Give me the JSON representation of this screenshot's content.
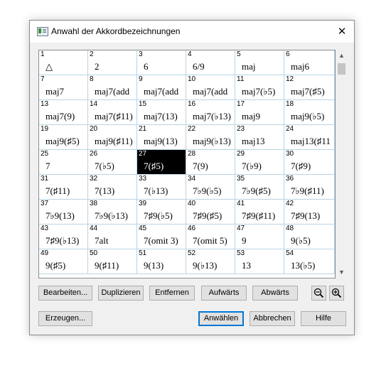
{
  "window": {
    "title": "Anwahl der Akkordbezeichnungen",
    "close_glyph": "✕"
  },
  "chords": [
    {
      "num": "1",
      "label": "△"
    },
    {
      "num": "2",
      "label": "2"
    },
    {
      "num": "3",
      "label": "6"
    },
    {
      "num": "4",
      "label": "6/9"
    },
    {
      "num": "5",
      "label": "maj"
    },
    {
      "num": "6",
      "label": "maj6"
    },
    {
      "num": "7",
      "label": "maj7"
    },
    {
      "num": "8",
      "label": "maj7(add"
    },
    {
      "num": "9",
      "label": "maj7(add"
    },
    {
      "num": "10",
      "label": "maj7(add"
    },
    {
      "num": "11",
      "label": "maj7(♭5)"
    },
    {
      "num": "12",
      "label": "maj7(♯5)"
    },
    {
      "num": "13",
      "label": "maj7(9)"
    },
    {
      "num": "14",
      "label": "maj7(♯11)"
    },
    {
      "num": "15",
      "label": "maj7(13)"
    },
    {
      "num": "16",
      "label": "maj7(♭13)"
    },
    {
      "num": "17",
      "label": "maj9"
    },
    {
      "num": "18",
      "label": "maj9(♭5)"
    },
    {
      "num": "19",
      "label": "maj9(♯5)"
    },
    {
      "num": "20",
      "label": "maj9(♯11)"
    },
    {
      "num": "21",
      "label": "maj9(13)"
    },
    {
      "num": "22",
      "label": "maj9(♭13)"
    },
    {
      "num": "23",
      "label": "maj13"
    },
    {
      "num": "24",
      "label": "maj13(♯11"
    },
    {
      "num": "25",
      "label": "7"
    },
    {
      "num": "26",
      "label": "7(♭5)"
    },
    {
      "num": "27",
      "label": "7(♯5)"
    },
    {
      "num": "28",
      "label": "7(9)"
    },
    {
      "num": "29",
      "label": "7(♭9)"
    },
    {
      "num": "30",
      "label": "7(♯9)"
    },
    {
      "num": "31",
      "label": "7(♯11)"
    },
    {
      "num": "32",
      "label": "7(13)"
    },
    {
      "num": "33",
      "label": "7(♭13)"
    },
    {
      "num": "34",
      "label": "7♭9(♭5)"
    },
    {
      "num": "35",
      "label": "7♭9(♯5)"
    },
    {
      "num": "36",
      "label": "7♭9(♯11)"
    },
    {
      "num": "37",
      "label": "7♭9(13)"
    },
    {
      "num": "38",
      "label": "7♭9(♭13)"
    },
    {
      "num": "39",
      "label": "7♯9(♭5)"
    },
    {
      "num": "40",
      "label": "7♯9(♯5)"
    },
    {
      "num": "41",
      "label": "7♯9(♯11)"
    },
    {
      "num": "42",
      "label": "7♯9(13)"
    },
    {
      "num": "43",
      "label": "7♯9(♭13)"
    },
    {
      "num": "44",
      "label": "7alt"
    },
    {
      "num": "45",
      "label": "7(omit 3)"
    },
    {
      "num": "46",
      "label": "7(omit 5)"
    },
    {
      "num": "47",
      "label": "9"
    },
    {
      "num": "48",
      "label": "9(♭5)"
    },
    {
      "num": "49",
      "label": "9(♯5)"
    },
    {
      "num": "50",
      "label": "9(♯11)"
    },
    {
      "num": "51",
      "label": "9(13)"
    },
    {
      "num": "52",
      "label": "9(♭13)"
    },
    {
      "num": "53",
      "label": "13"
    },
    {
      "num": "54",
      "label": "13(♭5)"
    }
  ],
  "selected_chord": "27",
  "scrollbar": {
    "up_glyph": "▲",
    "down_glyph": "▼"
  },
  "buttons": {
    "edit": "Bearbeiten...",
    "duplicate": "Duplizieren",
    "remove": "Entfernen",
    "up": "Aufwärts",
    "down": "Abwärts",
    "generate": "Erzeugen...",
    "select": "Anwählen",
    "cancel": "Abbrechen",
    "help": "Hilfe"
  },
  "icons": {
    "window": "app-icon",
    "zoom_out": "zoom-out-icon",
    "zoom_in": "zoom-in-icon"
  },
  "colors": {
    "selected_cell": "#000000",
    "grid_line": "#b9d4e4",
    "default_button_border": "#0078d7"
  }
}
